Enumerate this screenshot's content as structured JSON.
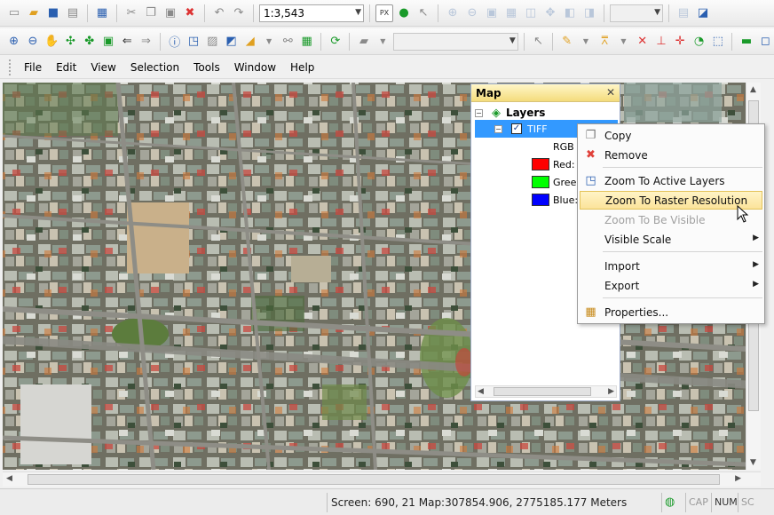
{
  "toolbar1": {
    "scale_value": "1:3,543",
    "scale_options_hint": "",
    "px_label": "PX",
    "right_combo_value": ""
  },
  "toolbar2": {
    "combo_value": ""
  },
  "menubar": {
    "items": [
      "File",
      "Edit",
      "View",
      "Selection",
      "Tools",
      "Window",
      "Help"
    ]
  },
  "panel": {
    "title": "Map",
    "root_label": "Layers",
    "layer_label": "TIFF",
    "rgb_label": "RGB C",
    "bands": [
      {
        "label": "Red: I",
        "color": "#ff0000"
      },
      {
        "label": "Green",
        "color": "#00ff00"
      },
      {
        "label": "Blue:",
        "color": "#0000ff"
      }
    ]
  },
  "context_menu": {
    "items": {
      "copy": "Copy",
      "remove": "Remove",
      "zoom_active": "Zoom To Active Layers",
      "zoom_raster": "Zoom To Raster Resolution",
      "zoom_visible": "Zoom To Be Visible",
      "visible_scale": "Visible Scale",
      "import": "Import",
      "export": "Export",
      "properties": "Properties..."
    }
  },
  "statusbar": {
    "coords": "Screen: 690, 21  Map:307854.906, 2775185.177 Meters",
    "cap": "CAP",
    "num": "NUM",
    "scrl": "SC"
  },
  "colors": {
    "accent_highlight": "#fbe39a",
    "panel_header": "#f4dc7c",
    "layer_selected": "#3399ff"
  }
}
